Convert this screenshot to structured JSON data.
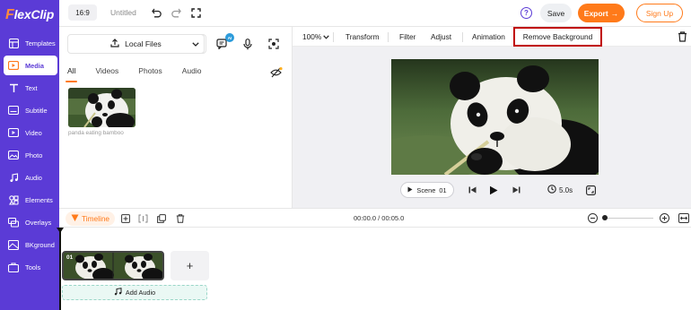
{
  "app": {
    "logo_prefix": "F",
    "logo_rest": "lexClip"
  },
  "sidebar": {
    "items": [
      {
        "label": "Templates",
        "icon": "templates-icon"
      },
      {
        "label": "Media",
        "icon": "media-icon",
        "active": true
      },
      {
        "label": "Text",
        "icon": "text-icon"
      },
      {
        "label": "Subtitle",
        "icon": "subtitle-icon"
      },
      {
        "label": "Video",
        "icon": "video-icon"
      },
      {
        "label": "Photo",
        "icon": "photo-icon"
      },
      {
        "label": "Audio",
        "icon": "audio-icon"
      },
      {
        "label": "Elements",
        "icon": "elements-icon"
      },
      {
        "label": "Overlays",
        "icon": "overlays-icon"
      },
      {
        "label": "BKground",
        "icon": "background-icon"
      },
      {
        "label": "Tools",
        "icon": "tools-icon"
      }
    ]
  },
  "topbar": {
    "aspect_ratio": "16:9",
    "doc_title": "Untitled",
    "help_label": "?",
    "save_label": "Save",
    "export_label": "Export",
    "export_arrow": "→",
    "signup_label": "Sign Up"
  },
  "media_panel": {
    "local_files_label": "Local Files",
    "ai_badge": "AI",
    "tabs": [
      "All",
      "Videos",
      "Photos",
      "Audio"
    ],
    "active_tab": "All",
    "items": [
      {
        "caption": "panda eating bamboo"
      }
    ]
  },
  "edit_toolbar": {
    "zoom": "100%",
    "items": [
      "Transform",
      "Filter",
      "Adjust",
      "Animation"
    ],
    "highlighted_item": "Remove Background"
  },
  "player": {
    "scene_label": "Scene",
    "scene_number": "01",
    "duration": "5.0s"
  },
  "timeline": {
    "label": "Timeline",
    "time_display": "00:00.0 / 00:05.0",
    "clip_number": "01",
    "add_scene_label": "+",
    "add_audio_label": "Add Audio"
  },
  "colors": {
    "sidebar": "#5b3bd6",
    "accent": "#ff7a1a",
    "highlight_box": "#c00000"
  }
}
